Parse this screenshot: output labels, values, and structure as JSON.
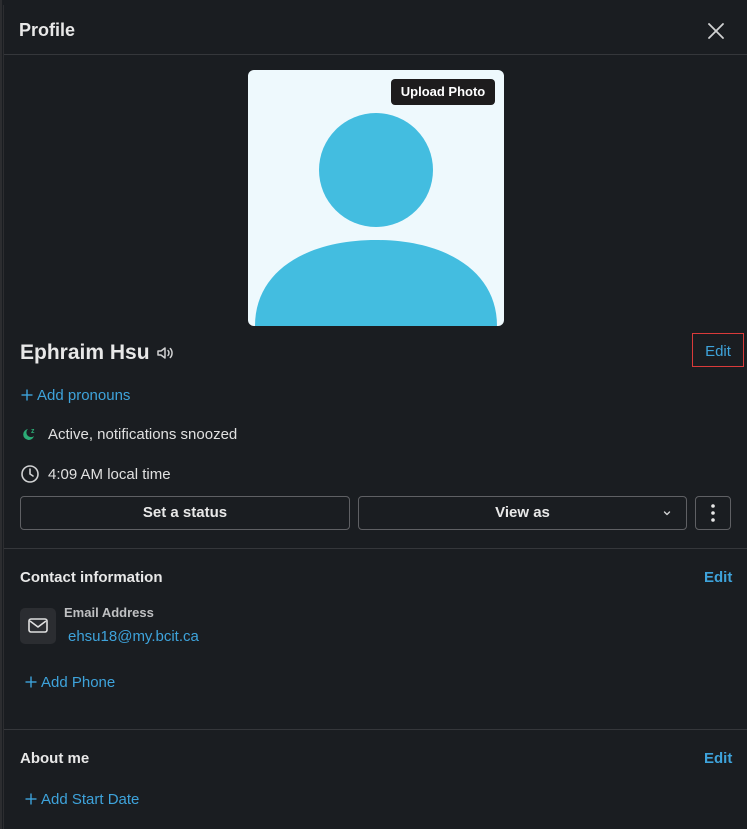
{
  "header": {
    "title": "Profile"
  },
  "avatar": {
    "upload_label": "Upload Photo",
    "bg_color": "#eef9fd",
    "figure_color": "#43bde0"
  },
  "profile": {
    "name": "Ephraim Hsu",
    "edit_label": "Edit",
    "add_pronouns_label": "Add pronouns",
    "status_text": "Active, notifications snoozed",
    "local_time_text": "4:09 AM local time"
  },
  "actions": {
    "set_status_label": "Set a status",
    "view_as_label": "View as"
  },
  "contact": {
    "title": "Contact information",
    "edit_label": "Edit",
    "email_label": "Email Address",
    "email_value": "ehsu18@my.bcit.ca",
    "add_phone_label": "Add Phone"
  },
  "about": {
    "title": "About me",
    "edit_label": "Edit",
    "add_start_date_label": "Add Start Date"
  },
  "colors": {
    "background": "#1a1d21",
    "link": "#3ea3db",
    "active_status": "#2bac76",
    "highlight_border": "#d93a3a"
  },
  "icons": {
    "close": "close-icon",
    "speaker": "speaker-icon",
    "status": "snooze-status-icon",
    "clock": "clock-icon",
    "chevron": "chevron-down-icon",
    "more": "more-vertical-icon",
    "mail": "mail-icon",
    "plus": "plus-icon"
  }
}
